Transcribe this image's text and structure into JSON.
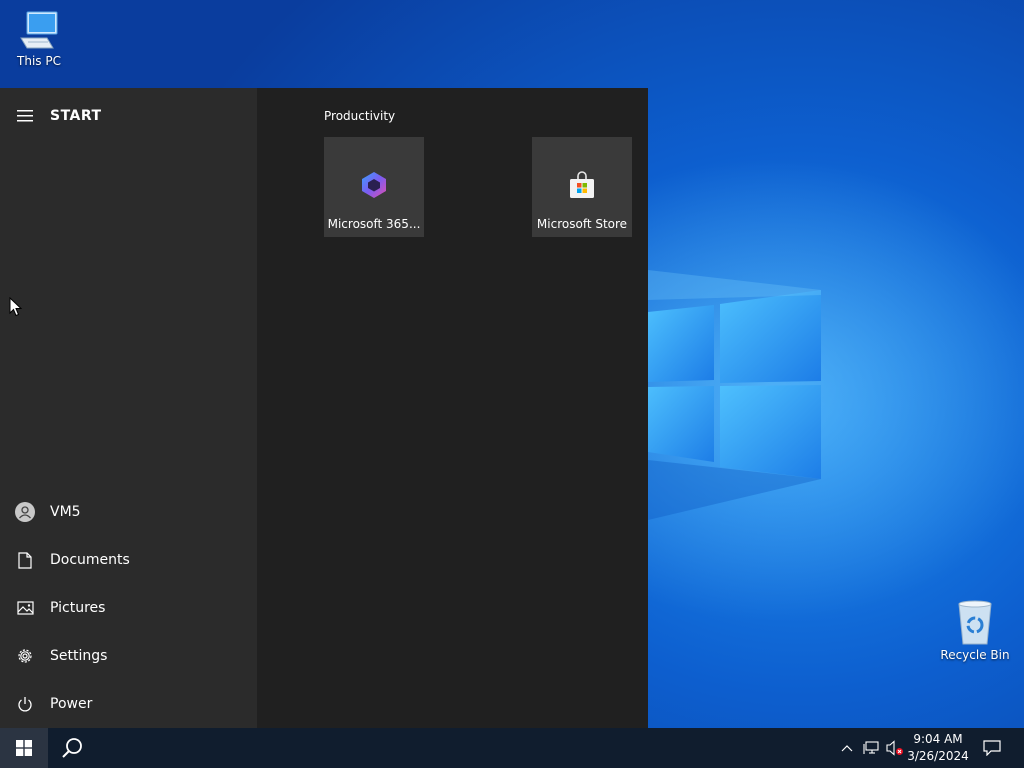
{
  "desktop": {
    "icons": [
      {
        "label": "This PC"
      },
      {
        "label": "Recycle Bin"
      }
    ]
  },
  "start_menu": {
    "title": "START",
    "nav": {
      "user": "VM5",
      "documents": "Documents",
      "pictures": "Pictures",
      "settings": "Settings",
      "power": "Power"
    },
    "group_label": "Productivity",
    "tiles": [
      {
        "label": "Microsoft 365...",
        "icon": "microsoft-365-icon"
      },
      {
        "label": "Microsoft Store",
        "icon": "store-bag-icon"
      }
    ]
  },
  "taskbar": {
    "clock": {
      "time": "9:04 AM",
      "date": "3/26/2024"
    },
    "icons": [
      "windows-logo-icon",
      "search-icon",
      "chevron-up-icon",
      "network-icon",
      "volume-muted-icon",
      "notification-icon"
    ]
  },
  "colors": {
    "start_bg": "#202020",
    "start_left_bg": "#2b2b2b",
    "tile_bg": "#3a3a3a",
    "taskbar_bg": "#101d2e",
    "wallpaper_blue": "#0d5fcf"
  }
}
